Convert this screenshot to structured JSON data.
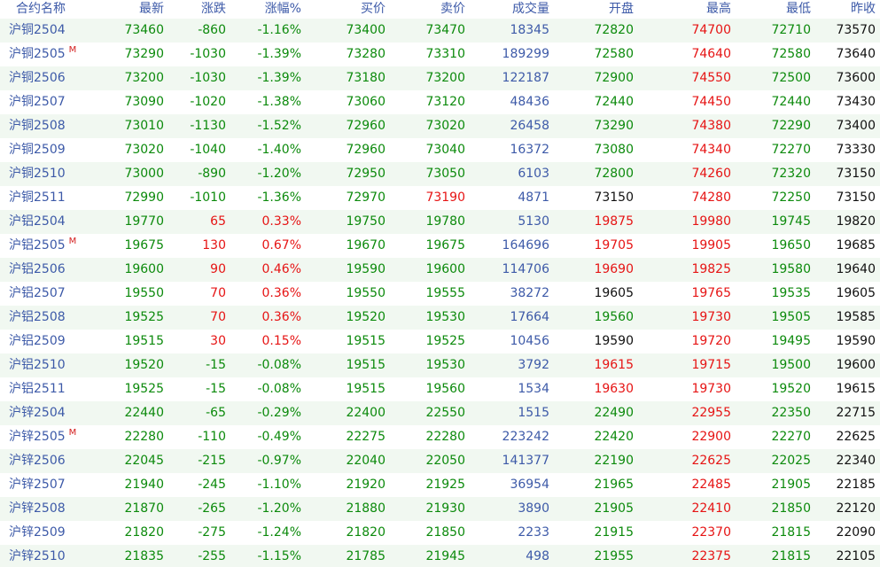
{
  "colors": {
    "up": "#e61414",
    "down": "#0c8a0c",
    "flat": "#111111",
    "volume": "#3d5aa8",
    "header": "#3d5aa8",
    "stripe": "#f1f8f1"
  },
  "columns": [
    "合约名称",
    "最新",
    "涨跌",
    "涨幅%",
    "买价",
    "卖价",
    "成交量",
    "开盘",
    "最高",
    "最低",
    "昨收"
  ],
  "rows": [
    {
      "name": "沪铜2504",
      "main": "",
      "last": "73460",
      "chg": "-860",
      "pct": "-1.16%",
      "bid": "73400",
      "ask": "73470",
      "vol": "18345",
      "open": "72820",
      "high": "74700",
      "low": "72710",
      "prev": "73570"
    },
    {
      "name": "沪铜2505",
      "main": "M",
      "last": "73290",
      "chg": "-1030",
      "pct": "-1.39%",
      "bid": "73280",
      "ask": "73310",
      "vol": "189299",
      "open": "72580",
      "high": "74640",
      "low": "72580",
      "prev": "73640"
    },
    {
      "name": "沪铜2506",
      "main": "",
      "last": "73200",
      "chg": "-1030",
      "pct": "-1.39%",
      "bid": "73180",
      "ask": "73200",
      "vol": "122187",
      "open": "72900",
      "high": "74550",
      "low": "72500",
      "prev": "73600"
    },
    {
      "name": "沪铜2507",
      "main": "",
      "last": "73090",
      "chg": "-1020",
      "pct": "-1.38%",
      "bid": "73060",
      "ask": "73120",
      "vol": "48436",
      "open": "72440",
      "high": "74450",
      "low": "72440",
      "prev": "73430"
    },
    {
      "name": "沪铜2508",
      "main": "",
      "last": "73010",
      "chg": "-1130",
      "pct": "-1.52%",
      "bid": "72960",
      "ask": "73020",
      "vol": "26458",
      "open": "73290",
      "high": "74380",
      "low": "72290",
      "prev": "73400"
    },
    {
      "name": "沪铜2509",
      "main": "",
      "last": "73020",
      "chg": "-1040",
      "pct": "-1.40%",
      "bid": "72960",
      "ask": "73040",
      "vol": "16372",
      "open": "73080",
      "high": "74340",
      "low": "72270",
      "prev": "73330"
    },
    {
      "name": "沪铜2510",
      "main": "",
      "last": "73000",
      "chg": "-890",
      "pct": "-1.20%",
      "bid": "72950",
      "ask": "73050",
      "vol": "6103",
      "open": "72800",
      "high": "74260",
      "low": "72320",
      "prev": "73150"
    },
    {
      "name": "沪铜2511",
      "main": "",
      "last": "72990",
      "chg": "-1010",
      "pct": "-1.36%",
      "bid": "72970",
      "ask": "73190",
      "vol": "4871",
      "open": "73150",
      "high": "74280",
      "low": "72250",
      "prev": "73150"
    },
    {
      "name": "沪铝2504",
      "main": "",
      "last": "19770",
      "chg": "65",
      "pct": "0.33%",
      "bid": "19750",
      "ask": "19780",
      "vol": "5130",
      "open": "19875",
      "high": "19980",
      "low": "19745",
      "prev": "19820"
    },
    {
      "name": "沪铝2505",
      "main": "M",
      "last": "19675",
      "chg": "130",
      "pct": "0.67%",
      "bid": "19670",
      "ask": "19675",
      "vol": "164696",
      "open": "19705",
      "high": "19905",
      "low": "19650",
      "prev": "19685"
    },
    {
      "name": "沪铝2506",
      "main": "",
      "last": "19600",
      "chg": "90",
      "pct": "0.46%",
      "bid": "19590",
      "ask": "19600",
      "vol": "114706",
      "open": "19690",
      "high": "19825",
      "low": "19580",
      "prev": "19640"
    },
    {
      "name": "沪铝2507",
      "main": "",
      "last": "19550",
      "chg": "70",
      "pct": "0.36%",
      "bid": "19550",
      "ask": "19555",
      "vol": "38272",
      "open": "19605",
      "high": "19765",
      "low": "19535",
      "prev": "19605"
    },
    {
      "name": "沪铝2508",
      "main": "",
      "last": "19525",
      "chg": "70",
      "pct": "0.36%",
      "bid": "19520",
      "ask": "19530",
      "vol": "17664",
      "open": "19560",
      "high": "19730",
      "low": "19505",
      "prev": "19585"
    },
    {
      "name": "沪铝2509",
      "main": "",
      "last": "19515",
      "chg": "30",
      "pct": "0.15%",
      "bid": "19515",
      "ask": "19525",
      "vol": "10456",
      "open": "19590",
      "high": "19720",
      "low": "19495",
      "prev": "19590"
    },
    {
      "name": "沪铝2510",
      "main": "",
      "last": "19520",
      "chg": "-15",
      "pct": "-0.08%",
      "bid": "19515",
      "ask": "19530",
      "vol": "3792",
      "open": "19615",
      "high": "19715",
      "low": "19500",
      "prev": "19600"
    },
    {
      "name": "沪铝2511",
      "main": "",
      "last": "19525",
      "chg": "-15",
      "pct": "-0.08%",
      "bid": "19515",
      "ask": "19560",
      "vol": "1534",
      "open": "19630",
      "high": "19730",
      "low": "19520",
      "prev": "19615"
    },
    {
      "name": "沪锌2504",
      "main": "",
      "last": "22440",
      "chg": "-65",
      "pct": "-0.29%",
      "bid": "22400",
      "ask": "22550",
      "vol": "1515",
      "open": "22490",
      "high": "22955",
      "low": "22350",
      "prev": "22715"
    },
    {
      "name": "沪锌2505",
      "main": "M",
      "last": "22280",
      "chg": "-110",
      "pct": "-0.49%",
      "bid": "22275",
      "ask": "22280",
      "vol": "223242",
      "open": "22420",
      "high": "22900",
      "low": "22270",
      "prev": "22625"
    },
    {
      "name": "沪锌2506",
      "main": "",
      "last": "22045",
      "chg": "-215",
      "pct": "-0.97%",
      "bid": "22040",
      "ask": "22050",
      "vol": "141377",
      "open": "22190",
      "high": "22625",
      "low": "22025",
      "prev": "22340"
    },
    {
      "name": "沪锌2507",
      "main": "",
      "last": "21940",
      "chg": "-245",
      "pct": "-1.10%",
      "bid": "21920",
      "ask": "21925",
      "vol": "36954",
      "open": "21965",
      "high": "22485",
      "low": "21905",
      "prev": "22185"
    },
    {
      "name": "沪锌2508",
      "main": "",
      "last": "21870",
      "chg": "-265",
      "pct": "-1.20%",
      "bid": "21880",
      "ask": "21930",
      "vol": "3890",
      "open": "21905",
      "high": "22410",
      "low": "21850",
      "prev": "22120"
    },
    {
      "name": "沪锌2509",
      "main": "",
      "last": "21820",
      "chg": "-275",
      "pct": "-1.24%",
      "bid": "21820",
      "ask": "21850",
      "vol": "2233",
      "open": "21915",
      "high": "22370",
      "low": "21815",
      "prev": "22090"
    },
    {
      "name": "沪锌2510",
      "main": "",
      "last": "21835",
      "chg": "-255",
      "pct": "-1.15%",
      "bid": "21785",
      "ask": "21945",
      "vol": "498",
      "open": "21955",
      "high": "22375",
      "low": "21815",
      "prev": "22105"
    }
  ]
}
